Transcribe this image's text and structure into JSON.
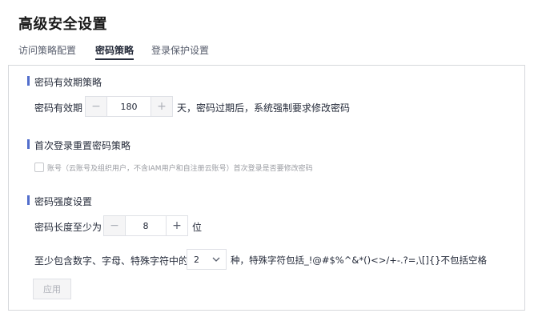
{
  "page_title": "高级安全设置",
  "tabs": [
    {
      "label": "访问策略配置"
    },
    {
      "label": "密码策略"
    },
    {
      "label": "登录保护设置"
    }
  ],
  "active_tab": "密码策略",
  "sections": {
    "validity": {
      "title": "密码有效期策略",
      "label": "密码有效期",
      "value": "180",
      "suffix": "天，密码过期后，系统强制要求修改密码",
      "minus_symbol": "−",
      "plus_symbol": "+"
    },
    "first_login": {
      "title": "首次登录重置密码策略",
      "checkbox_label": "账号（云账号及组织用户，不含IAM用户和自注册云账号）首次登录是否要修改密码",
      "checked": false
    },
    "strength": {
      "title": "密码强度设置",
      "min_length_label": "密码长度至少为",
      "min_length_value": "8",
      "min_length_unit": "位",
      "minus_symbol": "−",
      "plus_symbol": "+",
      "char_types_prefix": "至少包含数字、字母、特殊字符中的",
      "char_types_value": "2",
      "char_types_suffix": "种，特殊字符包括_!@#$%^&*()<>/+-.?=,\\[]{}不包括空格"
    }
  },
  "apply_label": "应用",
  "colors": {
    "accent": "#526ecc",
    "tab_active": "#252b3a",
    "border": "#d6d8dc",
    "disabled_text": "#adb0b8"
  },
  "icons": {
    "chevron": "chevron-down-icon"
  }
}
